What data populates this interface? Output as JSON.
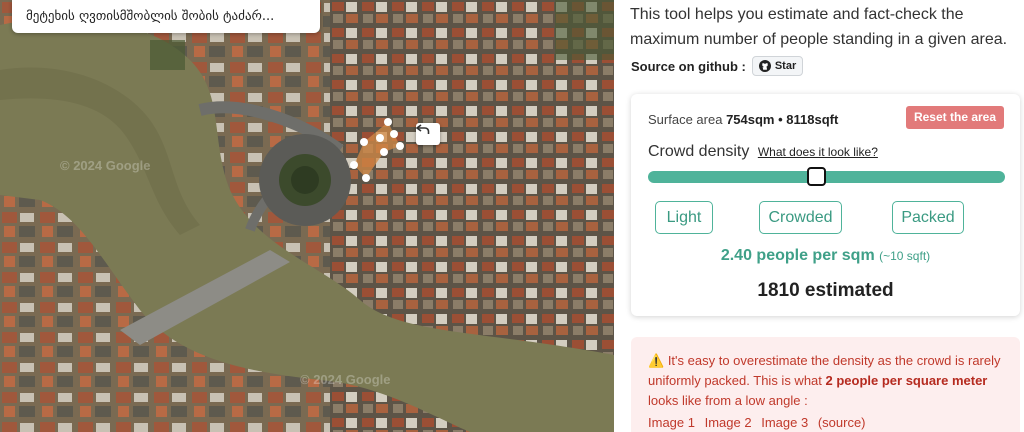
{
  "map": {
    "place_label": "მეტეხის ღვთისმშობლის შობის ტაძარ...",
    "watermark": "© 2024 Google"
  },
  "intro_text": "This tool helps you estimate and fact-check the maximum number of people standing in a given area.",
  "github": {
    "label": "Source on github :",
    "star_label": "Star"
  },
  "surface": {
    "label": "Surface area",
    "sqm": "754sqm",
    "sep": "•",
    "sqft": "8118sqft"
  },
  "reset_label": "Reset the area",
  "density": {
    "title": "Crowd density",
    "link": "What does it look like?",
    "slider_value": 0.47,
    "presets": [
      "Light",
      "Crowded",
      "Packed"
    ],
    "per_sqm": "2.40 people per sqm",
    "per_sqft": "(~10 sqft)"
  },
  "estimate": "1810 estimated",
  "warning": {
    "icon": "⚠️",
    "text_1": "It's easy to overestimate the density as the crowd is rarely uniformly packed. This is what",
    "bold": "2 people per square meter",
    "text_2": "looks like from a low angle :",
    "links": [
      "Image 1",
      "Image 2",
      "Image 3",
      "(source)"
    ]
  },
  "colors": {
    "accent": "#4fb39a",
    "reset": "#e27a7a",
    "warning_bg": "#fdeeee",
    "warning_text": "#c0392b"
  }
}
